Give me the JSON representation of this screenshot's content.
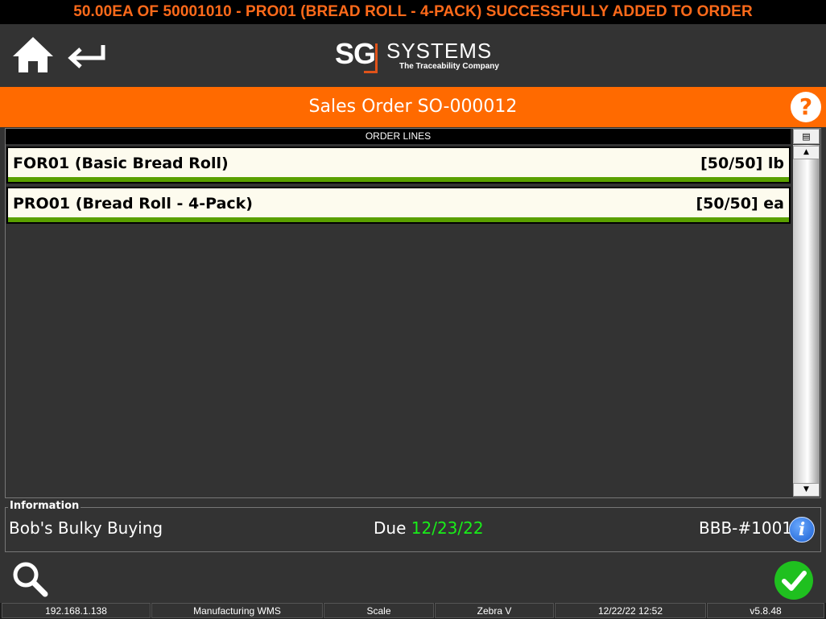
{
  "notification": "50.00EA OF 50001010 - PRO01 (BREAD ROLL - 4-PACK) SUCCESSFULLY ADDED TO ORDER",
  "header": {
    "logo": {
      "sg": "SG",
      "systems": "SYSTEMS",
      "tagline": "The Traceability Company"
    }
  },
  "title": "Sales Order SO-000012",
  "help_label": "?",
  "order_lines": {
    "header": "ORDER LINES",
    "items": [
      {
        "name": "FOR01 (Basic Bread Roll)",
        "qty": "[50/50] lb",
        "progress": 1.0
      },
      {
        "name": "PRO01 (Bread Roll - 4-Pack)",
        "qty": "[50/50] ea",
        "progress": 1.0
      }
    ]
  },
  "info": {
    "legend": "Information",
    "customer": "Bob's Bulky Buying",
    "due_label": "Due",
    "due_date": "12/23/22",
    "reference": "BBB-#1001",
    "info_icon_label": "i"
  },
  "status_bar": {
    "ip": "192.168.1.138",
    "app": "Manufacturing WMS",
    "scale": "Scale",
    "printer": "Zebra V",
    "datetime": "12/22/22 12:52",
    "version": "v5.8.48"
  },
  "colors": {
    "accent_orange": "#ff6a00",
    "progress_green": "#5aa000",
    "due_green": "#19ee19",
    "confirm_green": "#1fc01f"
  },
  "icons": [
    "home-icon",
    "back-arrow-icon",
    "help-icon",
    "info-icon",
    "search-icon",
    "checkmark-icon"
  ]
}
